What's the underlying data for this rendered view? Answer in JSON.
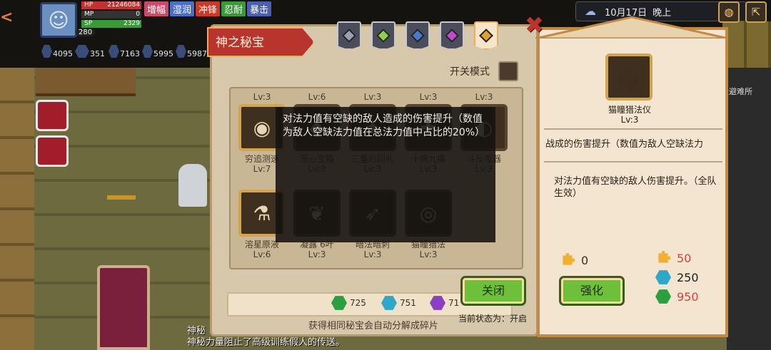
{
  "hud": {
    "player_level": "280",
    "hp_label": "HP",
    "hp_value": "21246084",
    "mp_label": "MP",
    "mp_value": "0",
    "sp_label": "SP",
    "sp_value": "2329",
    "tags": [
      {
        "label": "增幅",
        "color": "#c94a6a"
      },
      {
        "label": "湿润",
        "color": "#4b6fc9"
      },
      {
        "label": "冲锋",
        "color": "#c93a2a"
      },
      {
        "label": "忍耐",
        "color": "#3a9a3a"
      },
      {
        "label": "暴击",
        "color": "#4a5fb0"
      }
    ],
    "resources": [
      "4095",
      "351",
      "7163",
      "5995",
      "5987"
    ]
  },
  "topbar": {
    "date": "10月17日",
    "time_of_day": "晚上"
  },
  "scene": {
    "right_label": "量避难所",
    "bottom_message_1": "神秘",
    "bottom_message_2": "神秘力量阻止了高级训练假人的传送。"
  },
  "panel": {
    "title": "神之秘宝",
    "toggle_label": "开关模式",
    "tabs": [
      {
        "gem_color": "#9aa0b0"
      },
      {
        "gem_color": "#8fd04a"
      },
      {
        "gem_color": "#4a7ad0"
      },
      {
        "gem_color": "#c04ad0"
      },
      {
        "gem_color": "#e0a030",
        "active": true
      }
    ],
    "row1": [
      {
        "lv_top": "Lv:3",
        "name": "穷追测速",
        "lv_bottom": "Lv:7",
        "icon": "◉",
        "frame": "gold"
      },
      {
        "lv_top": "Lv:6",
        "name": "恶心宝箱",
        "lv_bottom": "Lv:3",
        "icon": "◆",
        "frame": "dark"
      },
      {
        "lv_top": "Lv:3",
        "name": "三重的回礼",
        "lv_bottom": "Lv:3",
        "icon": "✦",
        "frame": "dark"
      },
      {
        "lv_top": "Lv:3",
        "name": "十病九痛",
        "lv_bottom": "Lv:3",
        "icon": "✚",
        "frame": "dark"
      },
      {
        "lv_top": "Lv:3",
        "name": "斗反噬器",
        "lv_bottom": "Lv:3",
        "icon": "◐",
        "frame": "dark"
      }
    ],
    "row2": [
      {
        "name": "溶星原液",
        "lv_bottom": "Lv:6",
        "icon": "⚗",
        "frame": "gold"
      },
      {
        "name": "凝露 6叶",
        "lv_bottom": "Lv:3",
        "icon": "❦",
        "frame": "dark"
      },
      {
        "name": "暗法暗刺",
        "lv_bottom": "Lv:3",
        "icon": "➶",
        "frame": "dark"
      },
      {
        "name": "猫瞳猎法",
        "lv_bottom": "Lv:3",
        "icon": "◎",
        "frame": "dark"
      }
    ],
    "tooltip": "对法力值有空缺的敌人造成的伤害提升（数值为敌人空缺法力值在总法力值中占比的20%）",
    "currencies": [
      {
        "value": "725",
        "color": "#2ca040"
      },
      {
        "value": "751",
        "color": "#2fa7c9"
      },
      {
        "value": "71",
        "color": "#8a40c0"
      }
    ],
    "footer_note": "获得相同秘宝会自动分解成碎片",
    "close_button": "关闭",
    "status": "当前状态为：开启"
  },
  "detail": {
    "item_name": "猫瞳猎法仪",
    "item_level": "Lv:3",
    "desc_partial": "战成的伤害提升（数值为敌人空缺法力",
    "desc_team": "对法力值有空缺的敌人伤害提升。（全队生效）",
    "owned_fragments": "0",
    "cost_fragments": "50",
    "cost_blue": "250",
    "cost_green": "950",
    "upgrade_button": "强化",
    "cost_red_color": "#d84040"
  }
}
